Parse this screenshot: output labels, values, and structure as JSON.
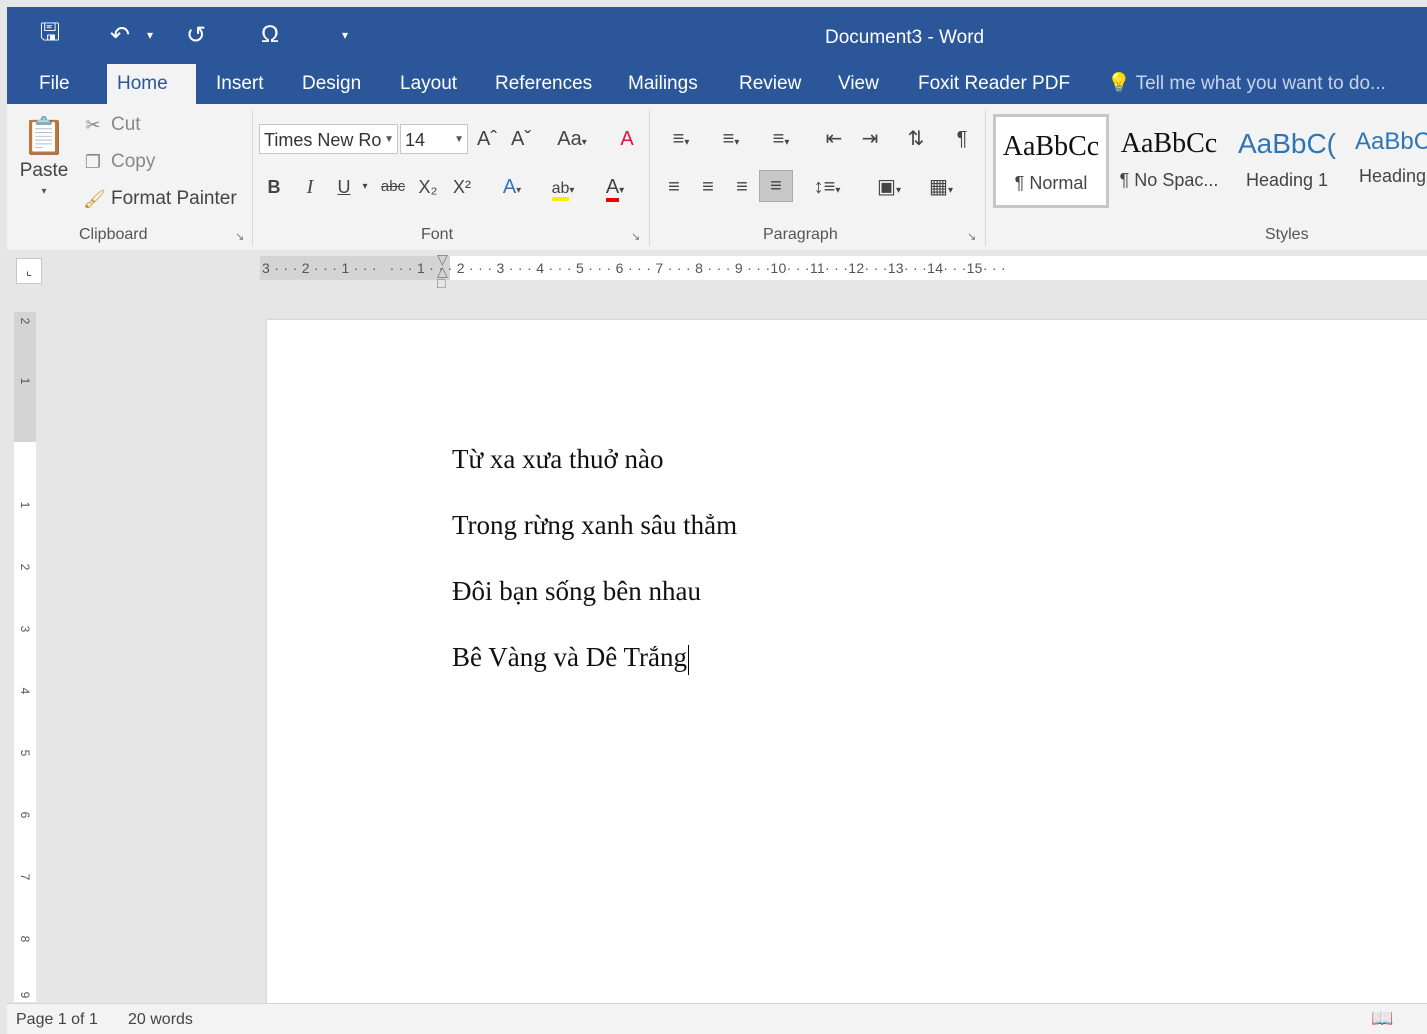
{
  "window": {
    "title": "Document3 - Word"
  },
  "qat": {
    "save_icon": "save-icon",
    "undo_icon": "undo-icon",
    "redo_icon": "redo-icon",
    "symbol_icon": "symbol-icon",
    "customize_icon": "customize-icon"
  },
  "tabs": [
    "File",
    "Home",
    "Insert",
    "Design",
    "Layout",
    "References",
    "Mailings",
    "Review",
    "View",
    "Foxit Reader PDF"
  ],
  "active_tab": "Home",
  "tell_me": "Tell me what you want to do...",
  "clipboard": {
    "paste": "Paste",
    "cut": "Cut",
    "copy": "Copy",
    "format_painter": "Format Painter",
    "label": "Clipboard"
  },
  "font": {
    "name": "Times New Ro",
    "size": "14",
    "grow": "Aˆ",
    "shrink": "Aˇ",
    "change_case": "Aa",
    "bold": "B",
    "italic": "I",
    "underline": "U",
    "strike": "abc",
    "label": "Font"
  },
  "paragraph": {
    "label": "Paragraph"
  },
  "styles": {
    "label": "Styles",
    "items": [
      {
        "preview": "AaBbCc",
        "name": "¶ Normal"
      },
      {
        "preview": "AaBbCc",
        "name": "¶ No Spac..."
      },
      {
        "preview": "AaBbC(",
        "name": "Heading 1"
      },
      {
        "preview": "AaBbC",
        "name": "Heading"
      }
    ]
  },
  "ruler": {
    "ticks": "3 · · · 2 · · · 1 · · ·   · · · 1 · · · 2 · · · 3 · · · 4 · · · 5 · · · 6 · · · 7 · · · 8 · · · 9 · · ·10· · ·11· · ·12· · ·13· · ·14· · ·15· · ·"
  },
  "document": {
    "lines": [
      "Từ xa xưa thuở nào",
      "Trong rừng xanh sâu thẳm",
      "Đôi bạn sống bên nhau",
      "Bê Vàng và Dê Trắng"
    ]
  },
  "status": {
    "page": "Page 1 of 1",
    "words": "20 words"
  }
}
